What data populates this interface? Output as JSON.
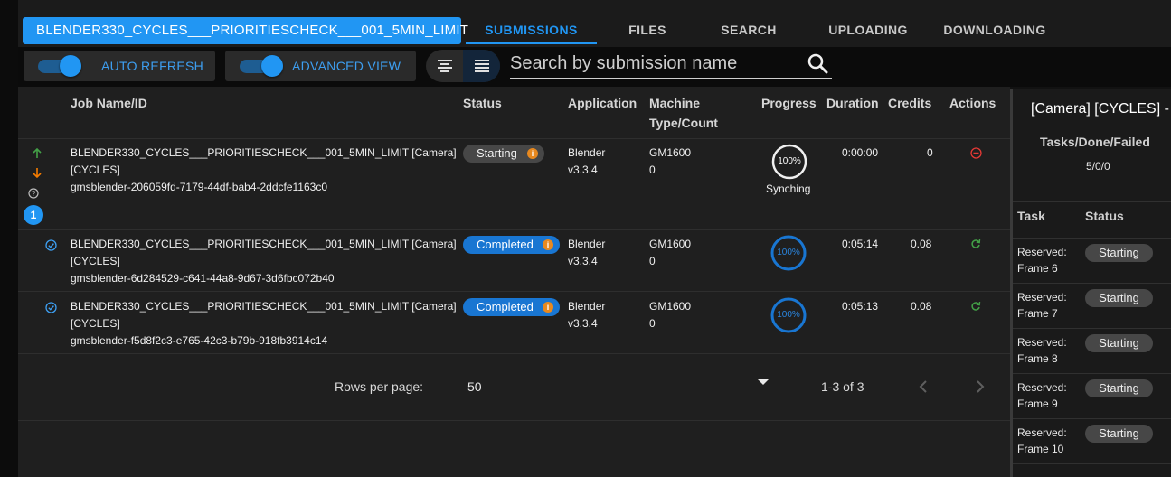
{
  "project_button": "BLENDER330_CYCLES___PRIORITIESCHECK___001_5MIN_LIMIT",
  "tabs": [
    {
      "label": "SUBMISSIONS",
      "active": true
    },
    {
      "label": "FILES",
      "active": false
    },
    {
      "label": "SEARCH",
      "active": false
    },
    {
      "label": "UPLOADING",
      "active": false
    },
    {
      "label": "DOWNLOADING",
      "active": false
    }
  ],
  "toolbar": {
    "auto_refresh": {
      "label": "AUTO REFRESH",
      "on": true
    },
    "advanced_view": {
      "label": "ADVANCED VIEW",
      "on": true
    },
    "search_placeholder": "Search by submission name"
  },
  "table": {
    "headers": {
      "job": "Job Name/ID",
      "status": "Status",
      "application": "Application",
      "machine_line1": "Machine",
      "machine_line2": "Type/Count",
      "progress": "Progress",
      "duration": "Duration",
      "credits": "Credits",
      "actions": "Actions"
    },
    "rows": [
      {
        "name_line1": "BLENDER330_CYCLES___PRIORITIESCHECK___001_5MIN_LIMIT [Camera]",
        "name_line2": "[CYCLES]",
        "id": "gmsblender-206059fd-7179-44df-bab4-2ddcfe1163c0",
        "status": "Starting",
        "app_name": "Blender",
        "app_version": "v3.3.4",
        "machine_type": "GM1600",
        "machine_count": "0",
        "progress": "100%",
        "progress_note": "Synching",
        "duration": "0:00:00",
        "credits": "0",
        "priority_badge": "1"
      },
      {
        "name_line1": "BLENDER330_CYCLES___PRIORITIESCHECK___001_5MIN_LIMIT [Camera]",
        "name_line2": "[CYCLES]",
        "id": "gmsblender-6d284529-c641-44a8-9d67-3d6fbc072b40",
        "status": "Completed",
        "app_name": "Blender",
        "app_version": "v3.3.4",
        "machine_type": "GM1600",
        "machine_count": "0",
        "progress": "100%",
        "duration": "0:05:14",
        "credits": "0.08"
      },
      {
        "name_line1": "BLENDER330_CYCLES___PRIORITIESCHECK___001_5MIN_LIMIT [Camera]",
        "name_line2": "[CYCLES]",
        "id": "gmsblender-f5d8f2c3-e765-42c3-b79b-918fb3914c14",
        "status": "Completed",
        "app_name": "Blender",
        "app_version": "v3.3.4",
        "machine_type": "GM1600",
        "machine_count": "0",
        "progress": "100%",
        "duration": "0:05:13",
        "credits": "0.08"
      }
    ]
  },
  "pagination": {
    "rows_per_page_label": "Rows per page:",
    "rows_per_page": "50",
    "range": "1-3 of 3"
  },
  "side_panel": {
    "title": "[Camera] [CYCLES] -",
    "tasks_header": "Tasks/Done/Failed",
    "tasks_counts": "5/0/0",
    "col_task": "Task",
    "col_status": "Status",
    "tasks": [
      {
        "label1": "Reserved:",
        "label2": "Frame 6",
        "status": "Starting"
      },
      {
        "label1": "Reserved:",
        "label2": "Frame 7",
        "status": "Starting"
      },
      {
        "label1": "Reserved:",
        "label2": "Frame 8",
        "status": "Starting"
      },
      {
        "label1": "Reserved:",
        "label2": "Frame 9",
        "status": "Starting"
      },
      {
        "label1": "Reserved:",
        "label2": "Frame 10",
        "status": "Starting"
      }
    ]
  },
  "colors": {
    "accent": "#2196f3",
    "completed": "#1976d2",
    "up_arrow": "#43a047",
    "down_arrow": "#f57c00",
    "cancel": "#e53935",
    "rerun": "#43a047"
  }
}
